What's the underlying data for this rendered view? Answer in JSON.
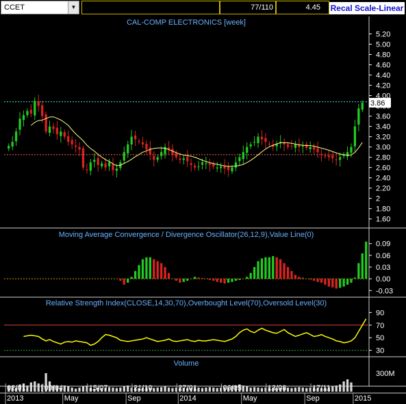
{
  "toolbar": {
    "symbol": "CCET",
    "field2": "",
    "bar_pos": "77/110",
    "last_value": "4.45",
    "recal_label": "Recal Scale-Linear"
  },
  "panels": {
    "price": {
      "title": "CAL-COMP ELECTRONICS [week]",
      "yticks": [
        "5.20",
        "5.00",
        "4.80",
        "4.60",
        "4.40",
        "4.20",
        "4.00",
        "3.80",
        "3.60",
        "3.40",
        "3.20",
        "3.00",
        "2.80",
        "2.60",
        "2.40",
        "2.20",
        "2",
        "1.80",
        "1.60"
      ],
      "last_price": "3.86"
    },
    "macd": {
      "title": "Moving Average Convergence / Divergence Oscillator(26,12,9),Value Line(0)",
      "yticks": [
        "0.09",
        "0.06",
        "0.03",
        "0.00",
        "-0.03"
      ]
    },
    "rsi": {
      "title": "Relative Strength Index(CLOSE,14,30,70),Overbought Level(70),Oversold Level(30)",
      "yticks": [
        "90",
        "70",
        "50",
        "30"
      ]
    },
    "volume": {
      "title": "Volume",
      "yticks": [
        "300M"
      ]
    }
  },
  "xaxis": {
    "top_labels": [
      "02/01",
      "09/04",
      "15/07",
      "21/10",
      "27/01",
      "06/05",
      "13/08",
      "17/11"
    ],
    "bottom_labels": [
      "2013",
      "May",
      "Sep",
      "2014",
      "May",
      "Sep",
      "2015"
    ]
  },
  "colors": {
    "up": "#22cc22",
    "down": "#dd2222",
    "ma": "#ffff80",
    "cyan_level": "#40e0e0",
    "red_level": "#ff6060",
    "panel_border": "#d0d0d0",
    "title": "#6ab0ff"
  },
  "chart_data": [
    {
      "type": "candlestick",
      "title": "CAL-COMP ELECTRONICS [week]",
      "ylim": [
        1.45,
        5.3
      ],
      "levels": [
        3.88,
        2.85
      ],
      "series": [
        {
          "name": "close",
          "values": [
            3.02,
            3.1,
            3.3,
            3.55,
            3.62,
            3.7,
            3.65,
            3.9,
            3.8,
            3.6,
            3.3,
            3.4,
            3.35,
            3.25,
            3.3,
            3.2,
            3.1,
            3.05,
            3.0,
            2.95,
            2.6,
            2.55,
            2.7,
            2.75,
            2.65,
            2.68,
            2.6,
            2.7,
            2.55,
            2.58,
            2.7,
            2.9,
            3.05,
            3.2,
            3.15,
            3.1,
            3.05,
            2.95,
            2.85,
            2.75,
            2.8,
            2.9,
            3.0,
            2.95,
            2.85,
            2.8,
            2.75,
            2.78,
            2.72,
            2.65,
            2.6,
            2.62,
            2.7,
            2.68,
            2.65,
            2.62,
            2.6,
            2.62,
            2.58,
            2.55,
            2.6,
            2.7,
            2.8,
            2.9,
            3.0,
            3.05,
            3.1,
            3.2,
            3.15,
            3.1,
            3.05,
            3.0,
            3.05,
            3.1,
            3.05,
            3.0,
            3.02,
            3.05,
            3.0,
            3.02,
            2.98,
            3.0,
            2.95,
            2.9,
            2.85,
            2.82,
            2.8,
            2.78,
            2.75,
            2.8,
            2.85,
            2.9,
            3.0,
            3.4,
            3.75,
            3.86
          ]
        },
        {
          "name": "MA",
          "values": []
        }
      ]
    },
    {
      "type": "bar",
      "title": "Moving Average Convergence / Divergence Oscillator(26,12,9),Value Line(0)",
      "ylim": [
        -0.04,
        0.1
      ],
      "values": [
        0,
        0,
        0,
        0,
        0,
        0,
        0,
        0,
        0,
        0,
        0,
        0,
        0,
        0,
        0,
        0,
        0,
        0,
        0,
        0,
        0,
        0,
        0,
        0,
        0,
        0,
        0,
        0,
        0,
        0,
        -0.005,
        -0.015,
        -0.01,
        0.005,
        0.02,
        0.035,
        0.05,
        0.055,
        0.055,
        0.05,
        0.045,
        0.04,
        0.03,
        0.015,
        0.0,
        -0.005,
        -0.01,
        -0.008,
        -0.005,
        0.0,
        0.005,
        0.003,
        0.002,
        0.0,
        -0.003,
        -0.005,
        -0.008,
        -0.01,
        -0.012,
        -0.01,
        -0.008,
        -0.005,
        -0.003,
        0.0,
        0.005,
        0.015,
        0.03,
        0.045,
        0.052,
        0.055,
        0.055,
        0.058,
        0.055,
        0.05,
        0.04,
        0.03,
        0.02,
        0.01,
        0.005,
        0.003,
        0.0,
        -0.002,
        -0.005,
        -0.008,
        -0.01,
        -0.015,
        -0.02,
        -0.022,
        -0.025,
        -0.023,
        -0.02,
        -0.015,
        -0.01,
        0.003,
        0.04,
        0.065,
        0.095
      ]
    },
    {
      "type": "line",
      "title": "Relative Strength Index(CLOSE,14,30,70),Overbought Level(70),Oversold Level(30)",
      "ylim": [
        22,
        98
      ],
      "levels": [
        70,
        30
      ],
      "values": [
        52,
        53,
        54,
        53,
        52,
        48,
        45,
        47,
        44,
        42,
        40,
        43,
        44,
        43,
        45,
        44,
        43,
        42,
        38,
        40,
        44,
        50,
        55,
        54,
        52,
        50,
        46,
        45,
        44,
        45,
        46,
        47,
        48,
        50,
        48,
        46,
        44,
        45,
        46,
        48,
        45,
        44,
        45,
        46,
        47,
        45,
        44,
        46,
        45,
        45,
        46,
        47,
        46,
        45,
        44,
        46,
        48,
        52,
        58,
        62,
        64,
        60,
        58,
        62,
        65,
        62,
        60,
        58,
        57,
        60,
        63,
        58,
        55,
        52,
        54,
        56,
        58,
        55,
        52,
        53,
        55,
        52,
        50,
        48,
        45,
        44,
        42,
        43,
        45,
        50,
        60,
        70,
        80
      ]
    },
    {
      "type": "bar",
      "title": "Volume",
      "values": [
        0.3,
        0.25,
        0.2,
        0.35,
        0.4,
        0.3,
        0.45,
        0.5,
        0.4,
        0.35,
        0.9,
        0.5,
        0.3,
        0.25,
        0.2,
        0.3,
        0.25,
        0.2,
        0.15,
        0.2,
        0.25,
        0.3,
        0.2,
        0.15,
        0.2,
        0.18,
        0.2,
        0.22,
        0.2,
        0.18,
        0.2,
        0.25,
        0.3,
        0.2,
        0.22,
        0.18,
        0.2,
        0.22,
        0.2,
        0.18,
        0.2,
        0.22,
        0.25,
        0.2,
        0.18,
        0.2,
        0.22,
        0.2,
        0.18,
        0.2,
        0.22,
        0.2,
        0.18,
        0.2,
        0.22,
        0.2,
        0.18,
        0.2,
        0.22,
        0.2,
        0.25,
        0.3,
        0.35,
        0.3,
        0.25,
        0.2,
        0.22,
        0.2,
        0.18,
        0.2,
        0.22,
        0.2,
        0.18,
        0.2,
        0.22,
        0.2,
        0.18,
        0.2,
        0.22,
        0.2,
        0.18,
        0.2,
        0.22,
        0.2,
        0.18,
        0.2,
        0.22,
        0.25,
        0.3,
        0.35,
        0.5,
        0.6,
        0.45
      ]
    }
  ]
}
